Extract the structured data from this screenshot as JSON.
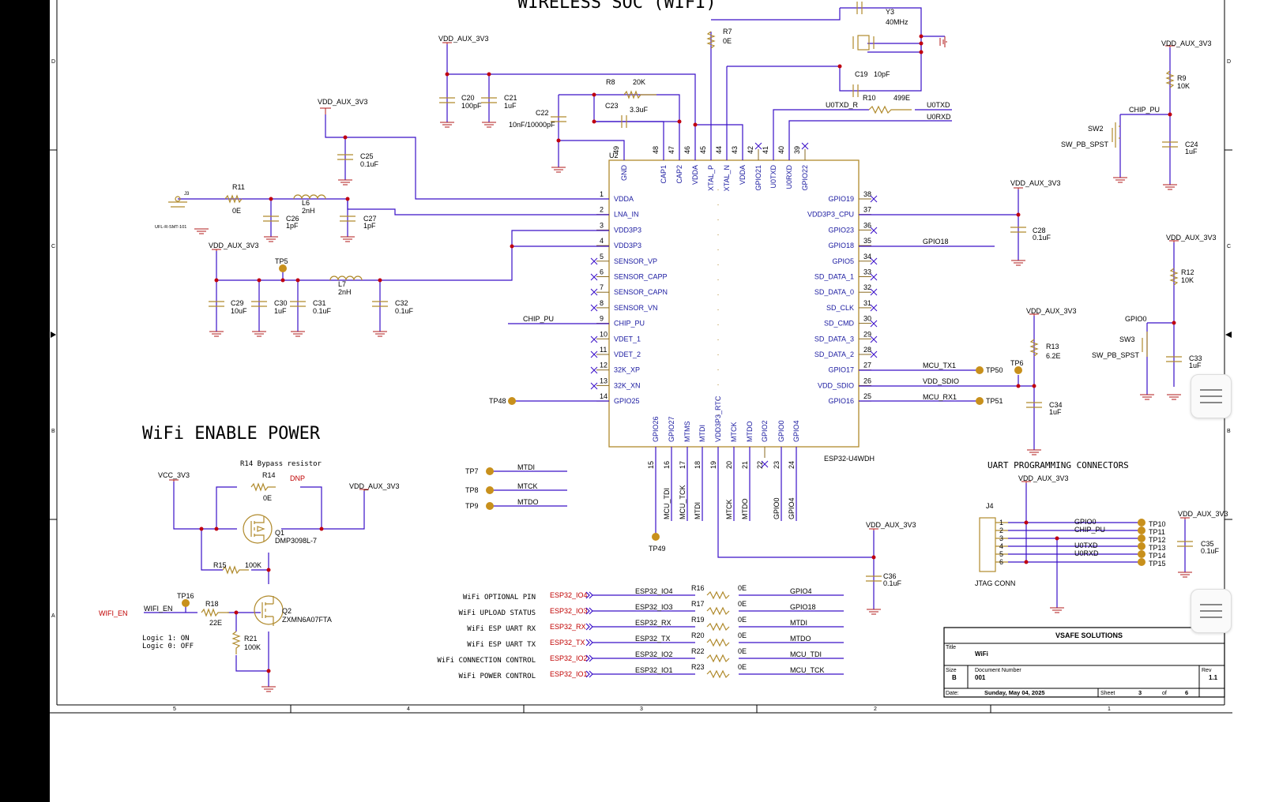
{
  "sheet_title_top": "WIRELESS SOC (WIFI)",
  "section_title": "WiFi ENABLE POWER",
  "uart_title": "UART PROGRAMMING CONNECTORS",
  "bypass_note": "R14 Bypass resistor",
  "logic_note": [
    "Logic 1: ON",
    "Logic 0: OFF"
  ],
  "border_rows": [
    "D",
    "C",
    "B",
    "A"
  ],
  "border_cols": [
    "5",
    "4",
    "3",
    "2",
    "1"
  ],
  "nets": {
    "vdd_aux": "VDD_AUX_3V3",
    "vcc": "VCC_3V3",
    "chip_pu": "CHIP_PU",
    "u0txd_r": "U0TXD_R",
    "u0txd": "U0TXD",
    "u0rxd": "U0RXD",
    "gpio18": "GPIO18",
    "gpio0": "GPIO0",
    "mcu_tx1": "MCU_TX1",
    "mcu_rx1": "MCU_RX1",
    "vdd_sdio": "VDD_SDIO",
    "mtdi": "MTDI",
    "mtck": "MTCK",
    "mtdo": "MTDO",
    "wifi_en_red": "WIFI_EN",
    "wifi_en": "WIFI_EN",
    "dnp": "DNP"
  },
  "u2": {
    "ref": "U2",
    "part": "ESP32-U4WDH",
    "left_pins": [
      {
        "num": "1",
        "name": "VDDA"
      },
      {
        "num": "2",
        "name": "LNA_IN"
      },
      {
        "num": "3",
        "name": "VDD3P3"
      },
      {
        "num": "4",
        "name": "VDD3P3"
      },
      {
        "num": "5",
        "name": "SENSOR_VP"
      },
      {
        "num": "6",
        "name": "SENSOR_CAPP"
      },
      {
        "num": "7",
        "name": "SENSOR_CAPN"
      },
      {
        "num": "8",
        "name": "SENSOR_VN"
      },
      {
        "num": "9",
        "name": "CHIP_PU"
      },
      {
        "num": "10",
        "name": "VDET_1"
      },
      {
        "num": "11",
        "name": "VDET_2"
      },
      {
        "num": "12",
        "name": "32K_XP"
      },
      {
        "num": "13",
        "name": "32K_XN"
      },
      {
        "num": "14",
        "name": "GPIO25"
      }
    ],
    "right_pins": [
      {
        "num": "38",
        "name": "GPIO19"
      },
      {
        "num": "37",
        "name": "VDD3P3_CPU"
      },
      {
        "num": "36",
        "name": "GPIO23"
      },
      {
        "num": "35",
        "name": "GPIO18"
      },
      {
        "num": "34",
        "name": "GPIO5"
      },
      {
        "num": "33",
        "name": "SD_DATA_1"
      },
      {
        "num": "32",
        "name": "SD_DATA_0"
      },
      {
        "num": "31",
        "name": "SD_CLK"
      },
      {
        "num": "30",
        "name": "SD_CMD"
      },
      {
        "num": "29",
        "name": "SD_DATA_3"
      },
      {
        "num": "28",
        "name": "SD_DATA_2"
      },
      {
        "num": "27",
        "name": "GPIO17"
      },
      {
        "num": "26",
        "name": "VDD_SDIO"
      },
      {
        "num": "25",
        "name": "GPIO16"
      }
    ],
    "top_pins": [
      {
        "num": "49",
        "name": "GND"
      },
      {
        "num": "48",
        "name": "CAP1"
      },
      {
        "num": "47",
        "name": "CAP2"
      },
      {
        "num": "46",
        "name": "VDDA"
      },
      {
        "num": "45",
        "name": "XTAL_P"
      },
      {
        "num": "44",
        "name": "XTAL_N"
      },
      {
        "num": "43",
        "name": "VDDA"
      },
      {
        "num": "42",
        "name": "GPIO21"
      },
      {
        "num": "41",
        "name": "U0TXD"
      },
      {
        "num": "40",
        "name": "U0RXD"
      },
      {
        "num": "39",
        "name": "GPIO22"
      }
    ],
    "bottom_pins": [
      {
        "num": "15",
        "name": "GPIO26"
      },
      {
        "num": "16",
        "name": "GPIO27"
      },
      {
        "num": "17",
        "name": "MTMS"
      },
      {
        "num": "18",
        "name": "MTDI"
      },
      {
        "num": "19",
        "name": "VDD3P3_RTC"
      },
      {
        "num": "20",
        "name": "MTCK"
      },
      {
        "num": "21",
        "name": "MTDO"
      },
      {
        "num": "22",
        "name": "GPIO2"
      },
      {
        "num": "23",
        "name": "GPIO0"
      },
      {
        "num": "24",
        "name": "GPIO4"
      }
    ],
    "bottom_nets": [
      "MCU_TDI",
      "MCU_TCK",
      "MTDI",
      "MTCK",
      "MTDO",
      "GPIO0",
      "GPIO4"
    ]
  },
  "components": {
    "r7": {
      "ref": "R7",
      "val": "0E"
    },
    "r8": {
      "ref": "R8",
      "val": "20K"
    },
    "r9": {
      "ref": "R9",
      "val": "10K"
    },
    "r10": {
      "ref": "R10",
      "val": "499E"
    },
    "r11": {
      "ref": "R11",
      "val": "0E"
    },
    "r12": {
      "ref": "R12",
      "val": "10K"
    },
    "r13": {
      "ref": "R13",
      "val": "6.2E"
    },
    "r14": {
      "ref": "R14",
      "val": "0E"
    },
    "r15": {
      "ref": "R15",
      "val": "100K"
    },
    "r18": {
      "ref": "R18",
      "val": "22E"
    },
    "r21": {
      "ref": "R21",
      "val": "100K"
    },
    "c19": {
      "ref": "C19",
      "val": "10pF"
    },
    "c20": {
      "ref": "C20",
      "val": "100pF"
    },
    "c21": {
      "ref": "C21",
      "val": "1uF"
    },
    "c22": {
      "ref": "C22",
      "val": "10nF/10000pF"
    },
    "c23": {
      "ref": "C23",
      "val": "3.3uF"
    },
    "c24": {
      "ref": "C24",
      "val": "1uF"
    },
    "c25": {
      "ref": "C25",
      "val": "0.1uF"
    },
    "c26": {
      "ref": "C26",
      "val": "1pF"
    },
    "c27": {
      "ref": "C27",
      "val": "1pF"
    },
    "c28": {
      "ref": "C28",
      "val": "0.1uF"
    },
    "c29": {
      "ref": "C29",
      "val": "10uF"
    },
    "c30": {
      "ref": "C30",
      "val": "1uF"
    },
    "c31": {
      "ref": "C31",
      "val": "0.1uF"
    },
    "c32": {
      "ref": "C32",
      "val": "0.1uF"
    },
    "c33": {
      "ref": "C33",
      "val": "1uF"
    },
    "c34": {
      "ref": "C34",
      "val": "1uF"
    },
    "c35": {
      "ref": "C35",
      "val": "0.1uF"
    },
    "c36": {
      "ref": "C36",
      "val": "0.1uF"
    },
    "l6": {
      "ref": "L6",
      "val": "2nH"
    },
    "l7": {
      "ref": "L7",
      "val": "2nH"
    },
    "y3": {
      "ref": "Y3",
      "val": "40MHz"
    },
    "j3": {
      "ref": "J3",
      "val": "UFL-R-SMT-101"
    },
    "sw2": {
      "ref": "SW2",
      "val": "SW_PB_SPST"
    },
    "sw3": {
      "ref": "SW3",
      "val": "SW_PB_SPST"
    },
    "q1": {
      "ref": "Q1",
      "val": "DMP3098L-7"
    },
    "q2": {
      "ref": "Q2",
      "val": "ZXMN6A07FTA"
    },
    "j4": {
      "ref": "J4",
      "val": "JTAG CONN"
    }
  },
  "test_points": [
    "TP5",
    "TP6",
    "TP7",
    "TP8",
    "TP9",
    "TP16",
    "TP48",
    "TP49",
    "TP50",
    "TP51"
  ],
  "jtag_tps": [
    "TP10",
    "TP11",
    "TP12",
    "TP13",
    "TP14",
    "TP15"
  ],
  "jtag_nets": [
    "GPIO0",
    "CHIP_PU",
    "",
    "U0TXD",
    "U0RXD",
    ""
  ],
  "series_rows": [
    {
      "desc": "WiFi OPTIONAL PIN",
      "port": "ESP32_IO4",
      "net_in": "ESP32_IO4",
      "ref": "R16",
      "val": "0E",
      "net_out": "GPIO4"
    },
    {
      "desc": "WiFi UPLOAD STATUS",
      "port": "ESP32_IO3",
      "net_in": "ESP32_IO3",
      "ref": "R17",
      "val": "0E",
      "net_out": "GPIO18"
    },
    {
      "desc": "WiFi ESP UART RX",
      "port": "ESP32_RX",
      "net_in": "ESP32_RX",
      "ref": "R19",
      "val": "0E",
      "net_out": "MTDI"
    },
    {
      "desc": "WiFi ESP UART TX",
      "port": "ESP32_TX",
      "net_in": "ESP32_TX",
      "ref": "R20",
      "val": "0E",
      "net_out": "MTDO"
    },
    {
      "desc": "WiFi CONNECTION CONTROL",
      "port": "ESP32_IO2",
      "net_in": "ESP32_IO2",
      "ref": "R22",
      "val": "0E",
      "net_out": "MCU_TDI"
    },
    {
      "desc": "WiFi POWER CONTROL",
      "port": "ESP32_IO1",
      "net_in": "ESP32_IO1",
      "ref": "R23",
      "val": "0E",
      "net_out": "MCU_TCK"
    }
  ],
  "title_block": {
    "company": "VSAFE SOLUTIONS",
    "title_label": "Title",
    "title": "WiFi",
    "size_label": "Size",
    "size": "B",
    "docnum_label": "Document Number",
    "docnum": "001",
    "rev_label": "Rev",
    "rev": "1.1",
    "date_label": "Date:",
    "date": "Sunday, May 04, 2025",
    "sheet_label": "Sheet",
    "sheet": "3",
    "of_label": "of",
    "of": "6"
  }
}
